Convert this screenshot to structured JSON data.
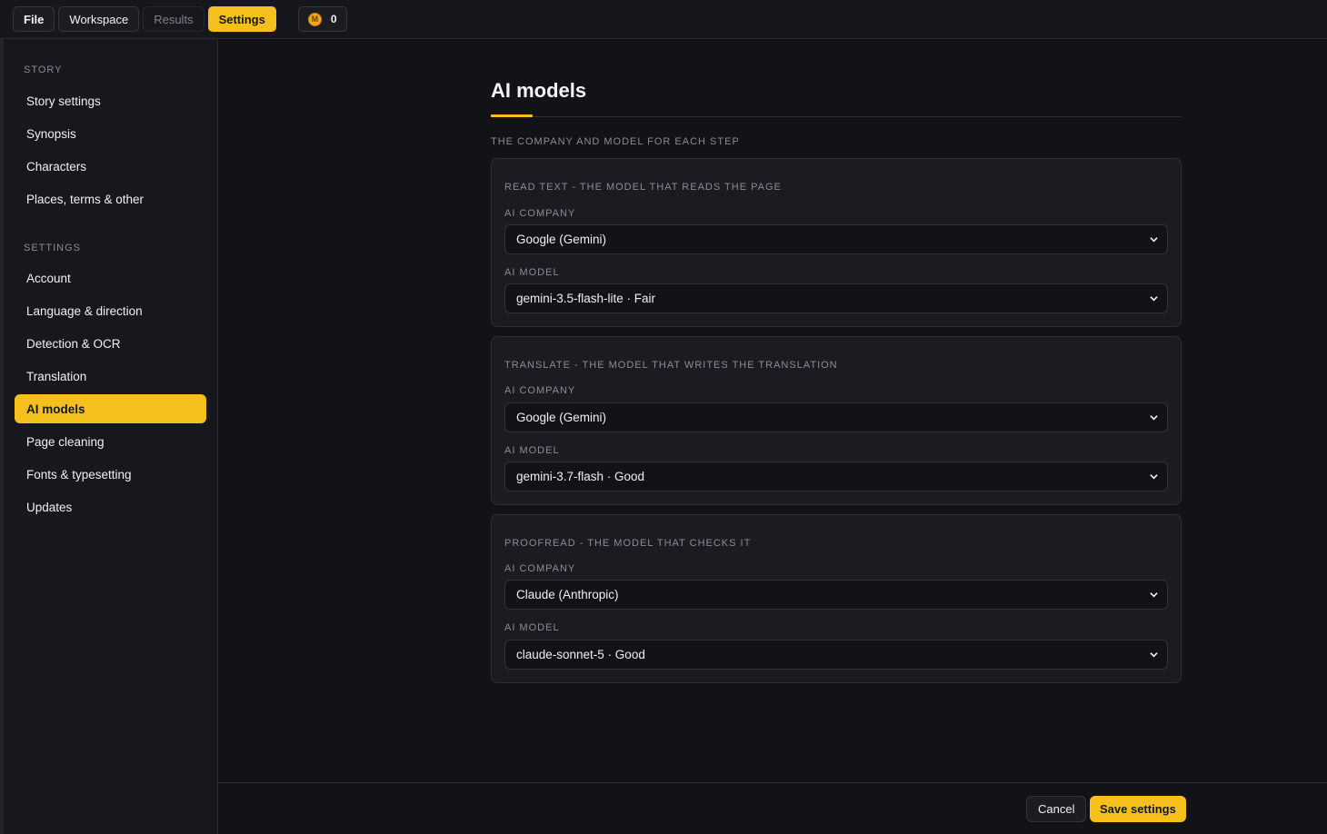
{
  "topbar": {
    "tabs": [
      {
        "label": "File"
      },
      {
        "label": "Workspace"
      },
      {
        "label": "Results"
      },
      {
        "label": "Settings"
      }
    ],
    "credits": {
      "coin_symbol": "M",
      "count": "0"
    }
  },
  "sidebar": {
    "story_heading": "STORY",
    "story_items": [
      {
        "label": "Story settings"
      },
      {
        "label": "Synopsis"
      },
      {
        "label": "Characters"
      },
      {
        "label": "Places, terms & other"
      }
    ],
    "settings_heading": "SETTINGS",
    "settings_items": [
      {
        "label": "Account"
      },
      {
        "label": "Language & direction"
      },
      {
        "label": "Detection & OCR"
      },
      {
        "label": "Translation"
      },
      {
        "label": "AI models"
      },
      {
        "label": "Page cleaning"
      },
      {
        "label": "Fonts & typesetting"
      },
      {
        "label": "Updates"
      }
    ]
  },
  "main": {
    "title": "AI models",
    "subheading": "THE COMPANY AND MODEL FOR EACH STEP",
    "cards": [
      {
        "title": "READ TEXT - THE MODEL THAT READS THE PAGE",
        "company_label": "AI COMPANY",
        "company_value": "Google (Gemini)",
        "model_label": "AI MODEL",
        "model_value": "gemini-3.5-flash-lite · Fair"
      },
      {
        "title": "TRANSLATE - THE MODEL THAT WRITES THE TRANSLATION",
        "company_label": "AI COMPANY",
        "company_value": "Google (Gemini)",
        "model_label": "AI MODEL",
        "model_value": "gemini-3.7-flash · Good"
      },
      {
        "title": "PROOFREAD - THE MODEL THAT CHECKS IT",
        "company_label": "AI COMPANY",
        "company_value": "Claude (Anthropic)",
        "model_label": "AI MODEL",
        "model_value": "claude-sonnet-5 · Good"
      }
    ]
  },
  "footer": {
    "cancel_label": "Cancel",
    "save_label": "Save settings"
  },
  "colors": {
    "accent": "#f6c01c",
    "background": "#121317",
    "panel": "#1b1c22"
  }
}
